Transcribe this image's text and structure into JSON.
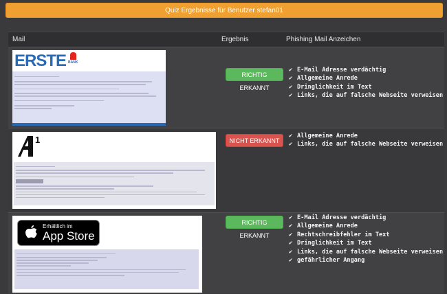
{
  "header": {
    "title": "Quiz Ergebnisse für Benutzer stefan01"
  },
  "table": {
    "columns": [
      "Mail",
      "Ergebnis",
      "Phishing Mail Anzeichen"
    ],
    "rows": [
      {
        "thumbnail": {
          "brand": "ERSTE",
          "sub": "BANK"
        },
        "result": "RICHTIG ERKANNT",
        "status": "correct",
        "indicators": [
          "E-Mail Adresse verdächtig",
          "Allgemeine Anrede",
          "Dringlichkeit im Text",
          "Links, die auf falsche Webseite verweisen"
        ]
      },
      {
        "thumbnail": {
          "brand": "A1",
          "sub": ""
        },
        "result": "NICHT ERKANNT",
        "status": "wrong",
        "indicators": [
          "Allgemeine Anrede",
          "Links, die auf falsche Webseite verweisen"
        ]
      },
      {
        "thumbnail": {
          "brand": "App Store",
          "sub": "Erhältlich im"
        },
        "result": "RICHTIG ERKANNT",
        "status": "correct",
        "indicators": [
          "E-Mail Adresse verdächtig",
          "Allgemeine Anrede",
          "Rechtschreibfehler im Text",
          "Dringlichkeit im Text",
          "Links, die auf falsche Webseite verweisen",
          "gefährlicher Angang"
        ]
      }
    ]
  },
  "icons": {
    "check": "check-icon",
    "apple": "apple-icon"
  },
  "colors": {
    "accent": "#f0a030",
    "success": "#5cb85c",
    "danger": "#d9534f",
    "background": "#3a3a3c",
    "erste_red": "#e2261c",
    "erste_blue": "#2a6bb5"
  }
}
